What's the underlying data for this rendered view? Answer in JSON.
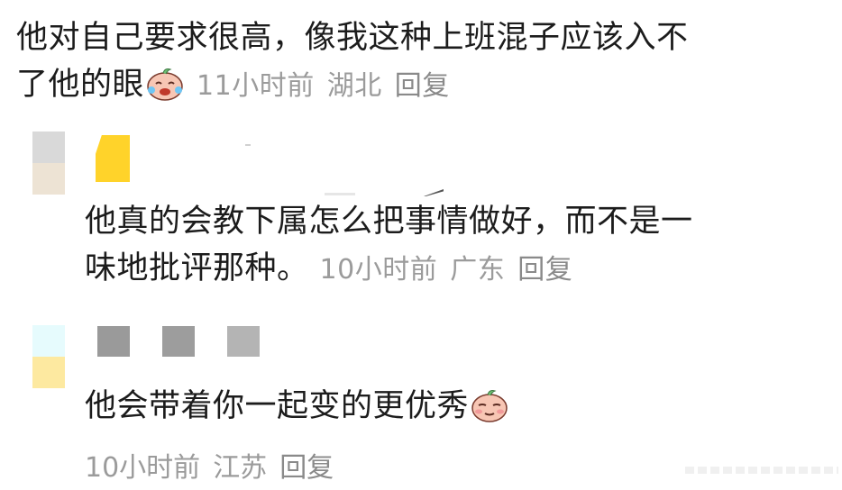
{
  "comments": [
    {
      "text_line1": "他对自己要求很高，像我这种上班混子应该入不",
      "text_line2": "了他的眼",
      "emoji": "crying-laughing-peach-icon",
      "time": "11小时前",
      "location": "湖北",
      "reply_label": "回复"
    },
    {
      "text_line1": "他真的会教下属怎么把事情做好，而不是一",
      "text_line2": "味地批评那种。",
      "time": "10小时前",
      "location": "广东",
      "reply_label": "回复"
    },
    {
      "text_line1": "他会带着你一起变的更优秀",
      "emoji": "smug-peach-icon",
      "time": "10小时前",
      "location": "江苏",
      "reply_label": "回复"
    }
  ],
  "colors": {
    "avatar_gray": "#d9d9d9",
    "avatar_beige": "#ede3d4",
    "avatar_yellow": "#ffd32a",
    "avatar_cyan": "#e6fbfd",
    "avatar_pale_yellow": "#fde9a0",
    "name_gray": "#9d9d9d",
    "meta_gray": "#9b9b9b"
  }
}
